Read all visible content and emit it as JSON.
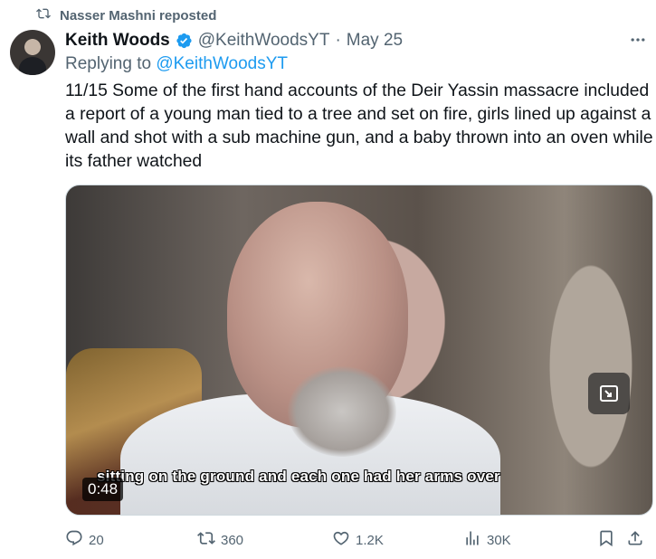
{
  "repost": {
    "text": "Nasser Mashni reposted",
    "icon": "repost-icon"
  },
  "author": {
    "name": "Keith Woods",
    "handle": "@KeithWoodsYT",
    "separator": "·",
    "date": "May 25",
    "verified": true,
    "verified_color": "#1d9bf0"
  },
  "replying": {
    "prefix": "Replying to",
    "mention": "@KeithWoodsYT"
  },
  "tweet": {
    "text": "11/15 Some of the first hand accounts of the Deir Yassin massacre included a report of a young man tied to a tree and set on fire, girls lined up against a wall and shot with a sub machine gun, and a baby thrown into an oven while its father watched"
  },
  "media": {
    "subtitle": "sitting on the ground and each one had her arms over",
    "timestamp": "0:48"
  },
  "actions": {
    "replies": "20",
    "reposts": "360",
    "likes": "1.2K",
    "views": "30K"
  },
  "colors": {
    "secondary_text": "#536471",
    "link": "#1d9bf0",
    "text": "#0f1419"
  }
}
